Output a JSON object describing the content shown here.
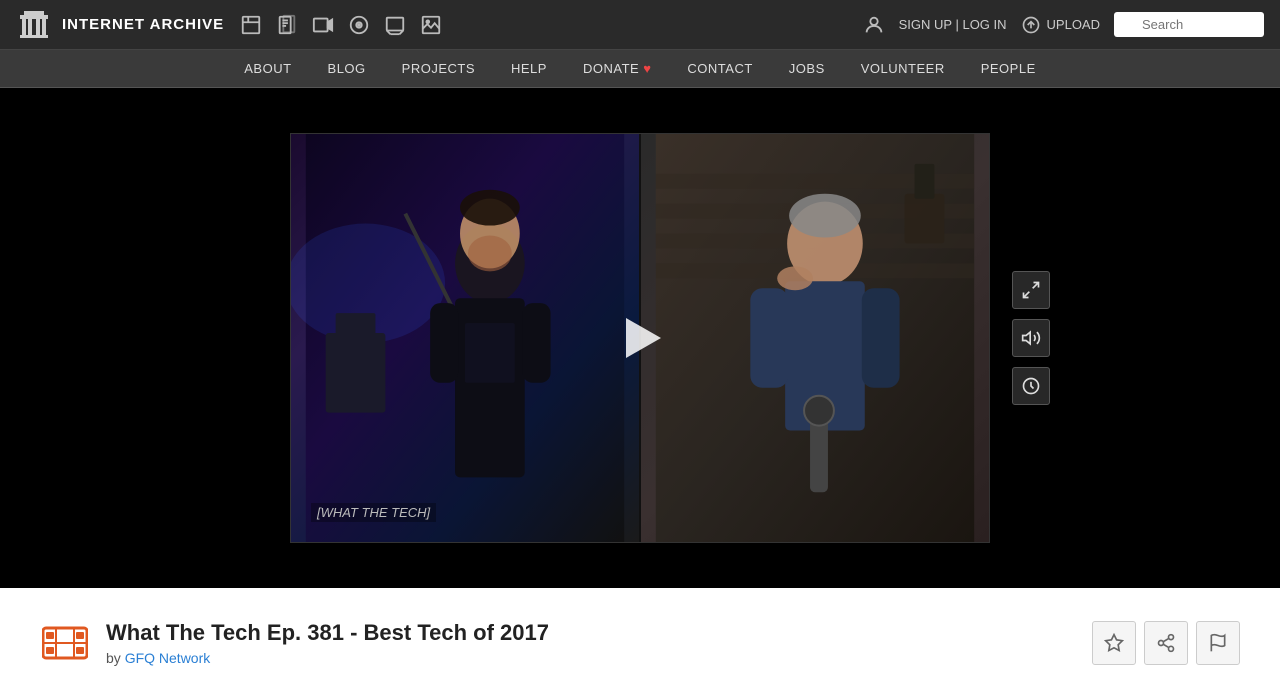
{
  "site": {
    "name": "INTERNET ARCHIVE"
  },
  "topnav": {
    "signupLogin": "SIGN UP | LOG IN",
    "upload": "UPLOAD",
    "search_placeholder": "Search"
  },
  "secnav": {
    "items": [
      {
        "label": "ABOUT",
        "id": "about"
      },
      {
        "label": "BLOG",
        "id": "blog"
      },
      {
        "label": "PROJECTS",
        "id": "projects"
      },
      {
        "label": "HELP",
        "id": "help"
      },
      {
        "label": "DONATE",
        "id": "donate",
        "hasHeart": true
      },
      {
        "label": "CONTACT",
        "id": "contact"
      },
      {
        "label": "JOBS",
        "id": "jobs"
      },
      {
        "label": "VOLUNTEER",
        "id": "volunteer"
      },
      {
        "label": "PEOPLE",
        "id": "people"
      }
    ]
  },
  "video": {
    "caption": "[WHAT THE TECH]",
    "playButtonLabel": "Play"
  },
  "item": {
    "title": "What The Tech Ep. 381 - Best Tech of 2017",
    "byLabel": "by",
    "author": "GFQ Network",
    "actions": {
      "favorite": "Favorite",
      "share": "Share",
      "flag": "Flag"
    }
  }
}
